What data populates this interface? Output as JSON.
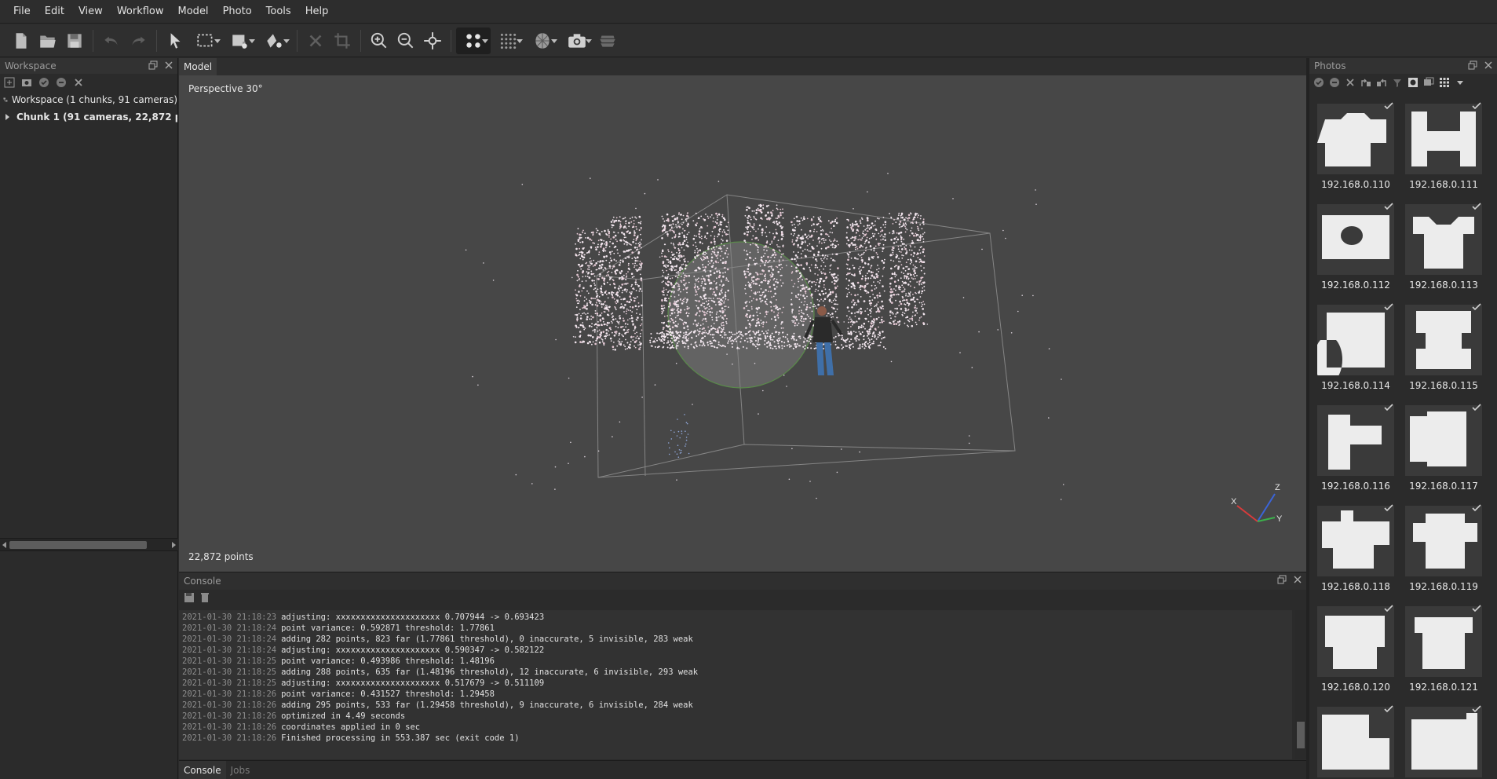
{
  "menubar": {
    "items": [
      {
        "label": "File"
      },
      {
        "label": "Edit"
      },
      {
        "label": "View"
      },
      {
        "label": "Workflow"
      },
      {
        "label": "Model"
      },
      {
        "label": "Photo"
      },
      {
        "label": "Tools"
      },
      {
        "label": "Help"
      }
    ]
  },
  "workspace": {
    "title": "Workspace",
    "root_label": "Workspace (1 chunks, 91 cameras)",
    "chunk_label": "Chunk 1 (91 cameras, 22,872 p"
  },
  "model": {
    "tab_label": "Model",
    "projection_label": "Perspective 30°",
    "points_label": "22,872 points",
    "axis_labels": {
      "x": "X",
      "y": "Y",
      "z": "Z"
    }
  },
  "console": {
    "title": "Console",
    "tabs": [
      {
        "label": "Console"
      },
      {
        "label": "Jobs"
      }
    ],
    "lines": [
      {
        "ts": "2021-01-30 21:18:23",
        "msg": "adjusting: xxxxxxxxxxxxxxxxxxxxx 0.707944 -> 0.693423"
      },
      {
        "ts": "2021-01-30 21:18:24",
        "msg": "point variance: 0.592871 threshold: 1.77861"
      },
      {
        "ts": "2021-01-30 21:18:24",
        "msg": "adding 282 points, 823 far (1.77861 threshold), 0 inaccurate, 5 invisible, 283 weak"
      },
      {
        "ts": "2021-01-30 21:18:24",
        "msg": "adjusting: xxxxxxxxxxxxxxxxxxxxx 0.590347 -> 0.582122"
      },
      {
        "ts": "2021-01-30 21:18:25",
        "msg": "point variance: 0.493986 threshold: 1.48196"
      },
      {
        "ts": "2021-01-30 21:18:25",
        "msg": "adding 288 points, 635 far (1.48196 threshold), 12 inaccurate, 6 invisible, 293 weak"
      },
      {
        "ts": "2021-01-30 21:18:25",
        "msg": "adjusting: xxxxxxxxxxxxxxxxxxxxx 0.517679 -> 0.511109"
      },
      {
        "ts": "2021-01-30 21:18:26",
        "msg": "point variance: 0.431527 threshold: 1.29458"
      },
      {
        "ts": "2021-01-30 21:18:26",
        "msg": "adding 295 points, 533 far (1.29458 threshold), 9 inaccurate, 6 invisible, 284 weak"
      },
      {
        "ts": "2021-01-30 21:18:26",
        "msg": "optimized in 4.49 seconds"
      },
      {
        "ts": "2021-01-30 21:18:26",
        "msg": "coordinates applied in 0 sec"
      },
      {
        "ts": "2021-01-30 21:18:26",
        "msg": "Finished processing in 553.387 sec (exit code 1)"
      }
    ]
  },
  "photos": {
    "title": "Photos",
    "thumbnails": [
      {
        "label": "192.168.0.110"
      },
      {
        "label": "192.168.0.111"
      },
      {
        "label": "192.168.0.112"
      },
      {
        "label": "192.168.0.113"
      },
      {
        "label": "192.168.0.114"
      },
      {
        "label": "192.168.0.115"
      },
      {
        "label": "192.168.0.116"
      },
      {
        "label": "192.168.0.117"
      },
      {
        "label": "192.168.0.118"
      },
      {
        "label": "192.168.0.119"
      },
      {
        "label": "192.168.0.120"
      },
      {
        "label": "192.168.0.121"
      },
      {
        "label": ""
      },
      {
        "label": ""
      }
    ]
  }
}
